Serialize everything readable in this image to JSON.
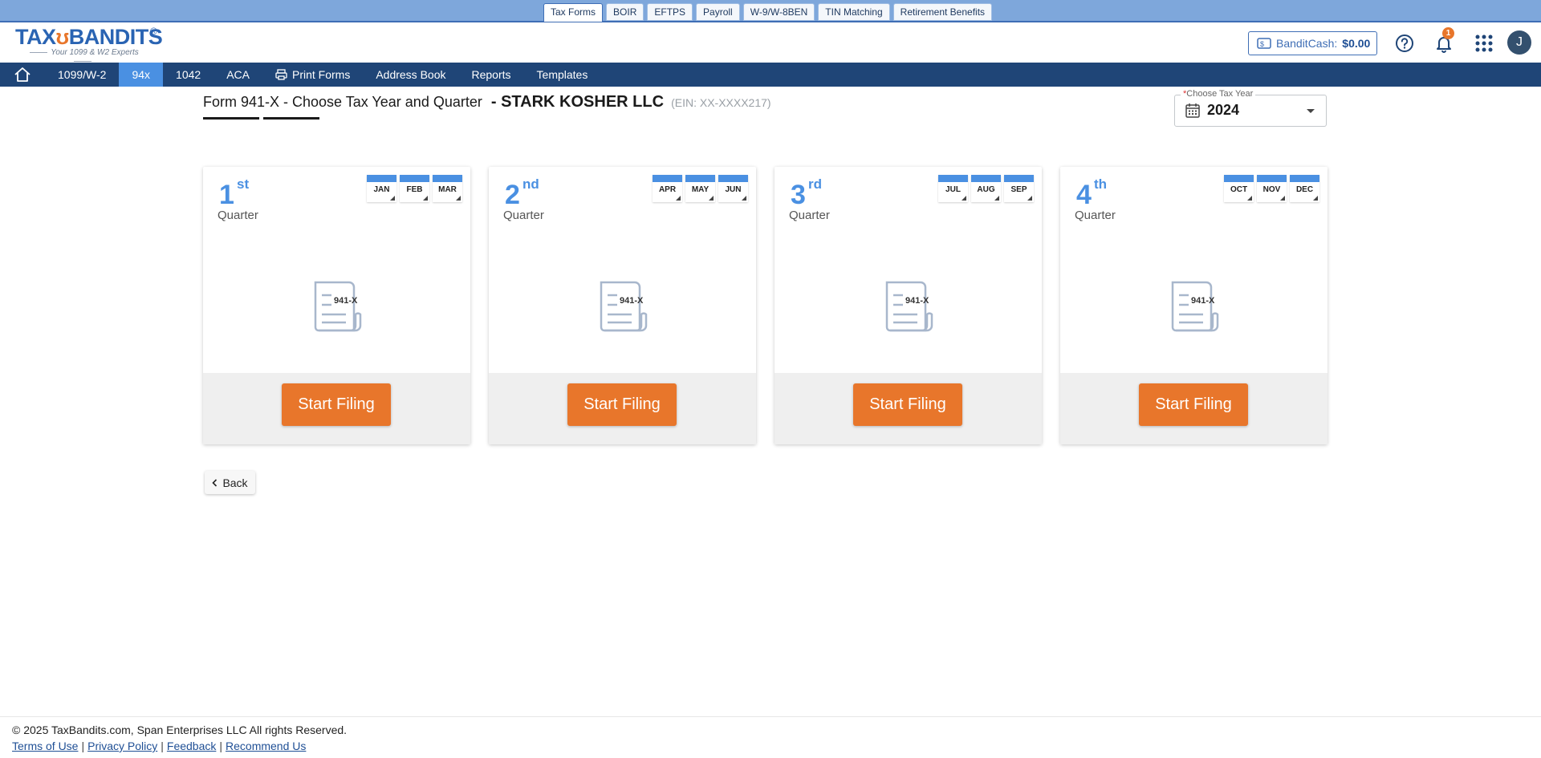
{
  "top_tabs": [
    {
      "label": "Tax Forms"
    },
    {
      "label": "BOIR"
    },
    {
      "label": "EFTPS"
    },
    {
      "label": "Payroll"
    },
    {
      "label": "W-9/W-8BEN"
    },
    {
      "label": "TIN Matching"
    },
    {
      "label": "Retirement Benefits"
    }
  ],
  "header": {
    "logo_text_a": "TAX",
    "logo_text_b": "BANDITS",
    "logo_reg": "®",
    "logo_tagline": "Your 1099 & W2 Experts",
    "bandit_cash_label": "BanditCash:",
    "bandit_cash_amount": "$0.00",
    "notification_count": "1",
    "avatar_initial": "J"
  },
  "nav": {
    "items": [
      {
        "label": "1099/W-2"
      },
      {
        "label": "94x"
      },
      {
        "label": "1042"
      },
      {
        "label": "ACA"
      },
      {
        "label": "Print Forms"
      },
      {
        "label": "Address Book"
      },
      {
        "label": "Reports"
      },
      {
        "label": "Templates"
      }
    ]
  },
  "page": {
    "title": "Form 941-X - Choose Tax Year and Quarter",
    "company": "- STARK KOSHER LLC",
    "ein": "(EIN: XX-XXXX217)"
  },
  "tax_year": {
    "legend_required": "*",
    "legend": "Choose Tax Year",
    "value": "2024"
  },
  "quarters": [
    {
      "num": "1",
      "suffix": "st",
      "word": "Quarter",
      "months": [
        "JAN",
        "FEB",
        "MAR"
      ],
      "form": "941-X",
      "button": "Start Filing"
    },
    {
      "num": "2",
      "suffix": "nd",
      "word": "Quarter",
      "months": [
        "APR",
        "MAY",
        "JUN"
      ],
      "form": "941-X",
      "button": "Start Filing"
    },
    {
      "num": "3",
      "suffix": "rd",
      "word": "Quarter",
      "months": [
        "JUL",
        "AUG",
        "SEP"
      ],
      "form": "941-X",
      "button": "Start Filing"
    },
    {
      "num": "4",
      "suffix": "th",
      "word": "Quarter",
      "months": [
        "OCT",
        "NOV",
        "DEC"
      ],
      "form": "941-X",
      "button": "Start Filing"
    }
  ],
  "back_label": "Back",
  "footer": {
    "copyright": "© 2025 TaxBandits.com, Span Enterprises LLC All rights Reserved.",
    "links": [
      "Terms of Use",
      "Privacy Policy",
      "Feedback",
      "Recommend Us"
    ]
  },
  "colors": {
    "accent_orange": "#e8762b",
    "nav_blue": "#1f4577",
    "active_blue": "#4a90e2"
  },
  "icons": {
    "home": "home-icon",
    "printer": "printer-icon",
    "help": "help-icon",
    "bell": "bell-icon",
    "apps": "apps-grid-icon",
    "calendar": "calendar-icon",
    "back": "chevron-left-icon",
    "document": "document-941x-icon"
  }
}
